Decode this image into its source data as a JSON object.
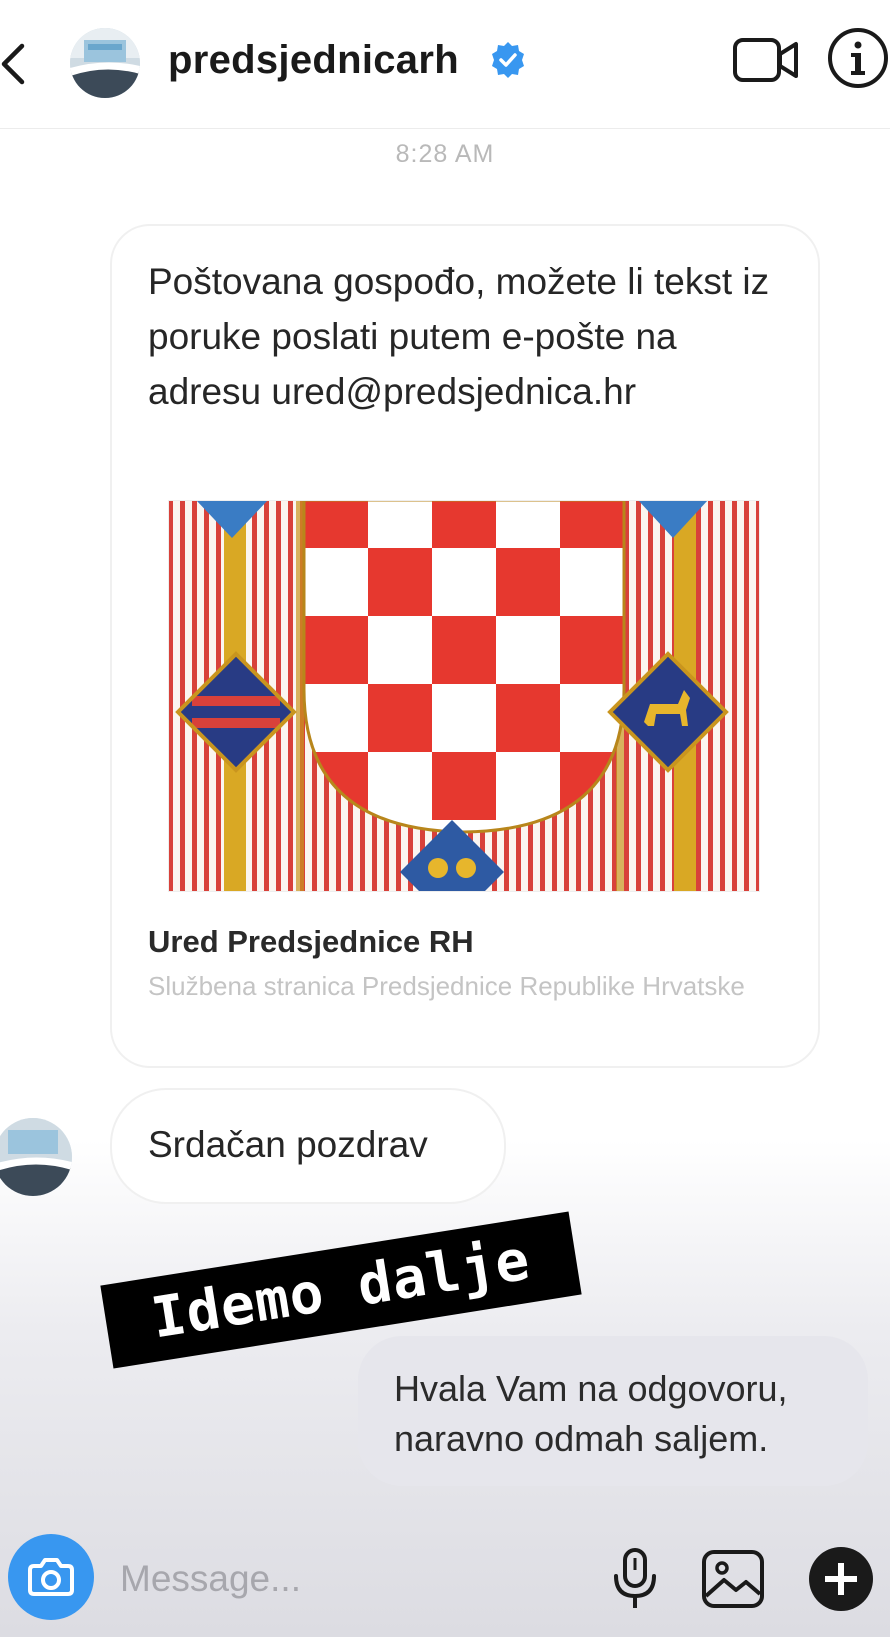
{
  "header": {
    "username": "predsjednicarh",
    "verified": true,
    "accent_color": "#3897f0"
  },
  "thread": {
    "timestamp": "8:28 AM",
    "shared_message": {
      "text": "Poštovana gospođo, možete li tekst iz poruke poslati putem e-pošte na adresu ured@predsjednica.hr",
      "link_title": "Ured Predsjednice RH",
      "link_description": "Službena stranica Predsjednice Republike Hrvatske"
    },
    "incoming_message": "Srdačan pozdrav",
    "sticker_text": "Idemo dalje",
    "outgoing_message": "Hvala Vam na odgovoru, naravno odmah saljem."
  },
  "composer": {
    "placeholder": "Message..."
  },
  "icons": {
    "back": "chevron-left-icon",
    "verified": "verified-badge-icon",
    "video": "video-camera-icon",
    "info": "info-icon",
    "camera": "camera-icon",
    "mic": "microphone-icon",
    "gallery": "image-gallery-icon",
    "add": "plus-circle-icon"
  }
}
